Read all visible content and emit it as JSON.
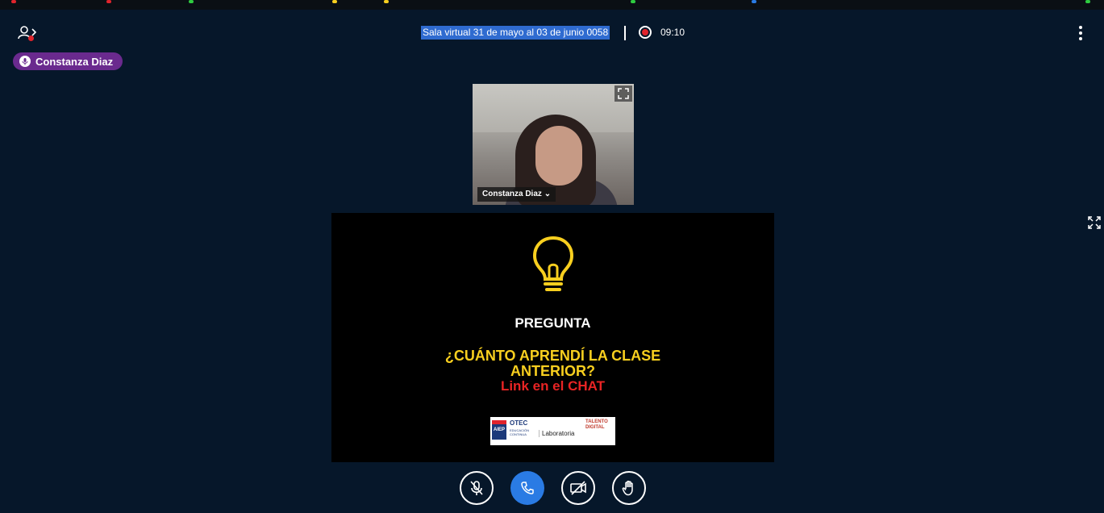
{
  "header": {
    "meeting_title": "Sala virtual 31 de mayo al 03 de junio 0058",
    "recording_time": "09:10"
  },
  "talking_indicator": {
    "name": "Constanza Diaz"
  },
  "webcam": {
    "user_name": "Constanza Diaz"
  },
  "presentation": {
    "heading": "PREGUNTA",
    "question_line1": "¿CUÁNTO APRENDÍ LA CLASE",
    "question_line2": "ANTERIOR?",
    "link_text": "Link en el CHAT",
    "logos": {
      "aiep": "AIEP",
      "otec": "OTEC",
      "otec_sub": "EDUCACIÓN CONTINUA",
      "laboratoria": "Laboratoria",
      "talento": "TALENTO DIGITAL"
    }
  },
  "colors": {
    "background": "#06172a",
    "talking_badge": "#6a2a8e",
    "title_highlight": "#2f6bd0",
    "recording": "#e0242c",
    "question_yellow": "#f8cf1f",
    "link_red": "#e82424",
    "phone_button": "#2a7be4"
  },
  "icons": {
    "users": "users-toggle-icon",
    "mic": "microphone-icon",
    "record": "record-icon",
    "options": "more-options-icon",
    "fullscreen": "fullscreen-icon",
    "bulb": "lightbulb-icon",
    "mute": "microphone-off-icon",
    "phone": "phone-icon",
    "camera": "camera-off-icon",
    "hand": "raise-hand-icon"
  }
}
